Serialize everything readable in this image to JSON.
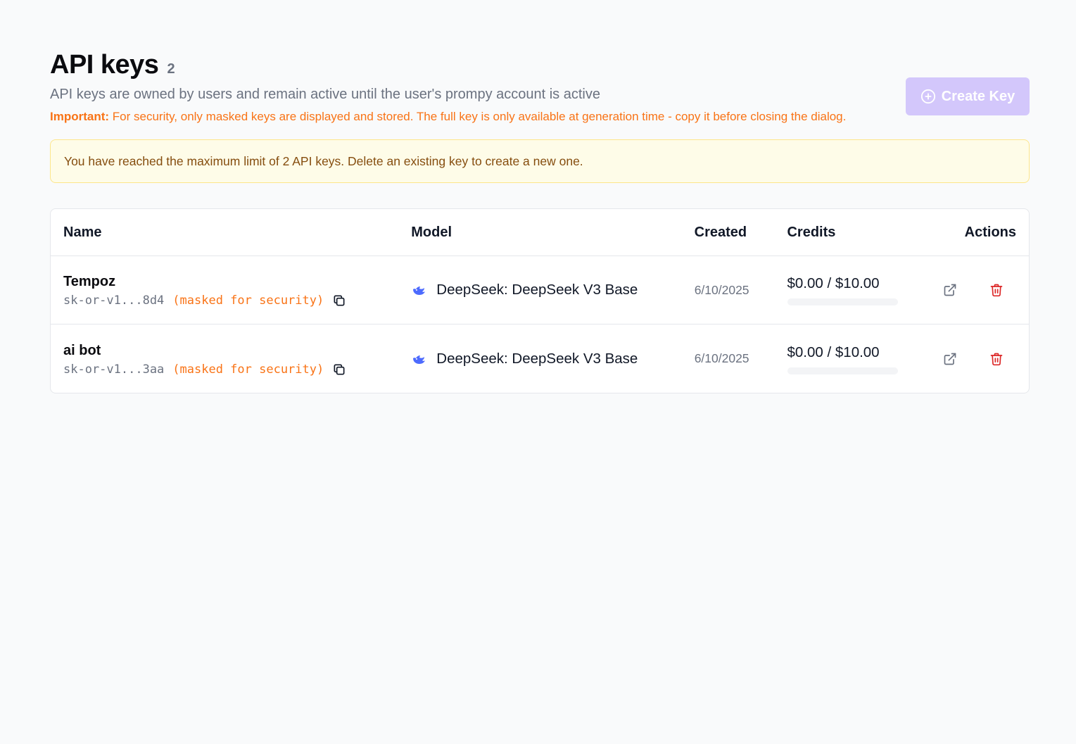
{
  "header": {
    "title": "API keys",
    "count": "2",
    "subtitle": "API keys are owned by users and remain active until the user's prompy account is active",
    "important_label": "Important:",
    "important_text": " For security, only masked keys are displayed and stored. The full key is only available at generation time - copy it before closing the dialog.",
    "create_button": "Create Key"
  },
  "alert": {
    "text": "You have reached the maximum limit of 2 API keys. Delete an existing key to create a new one."
  },
  "table": {
    "columns": {
      "name": "Name",
      "model": "Model",
      "created": "Created",
      "credits": "Credits",
      "actions": "Actions"
    },
    "rows": [
      {
        "name": "Tempoz",
        "key_masked": "sk-or-v1...8d4",
        "key_note": "(masked for security)",
        "model": "DeepSeek: DeepSeek V3 Base",
        "created": "6/10/2025",
        "credits": "$0.00 / $10.00",
        "credits_used_fraction": 0
      },
      {
        "name": "ai bot",
        "key_masked": "sk-or-v1...3aa",
        "key_note": "(masked for security)",
        "model": "DeepSeek: DeepSeek V3 Base",
        "created": "6/10/2025",
        "credits": "$0.00 / $10.00",
        "credits_used_fraction": 0
      }
    ]
  },
  "icons": {
    "create": "plus-circle-icon",
    "copy": "copy-icon",
    "model": "deepseek-whale-icon",
    "open": "external-link-icon",
    "delete": "trash-icon"
  },
  "colors": {
    "accent": "#d3c7fb",
    "important": "#f97316",
    "alert_bg": "#fefce8",
    "alert_text": "#854d0e",
    "delete": "#dc2626",
    "model_icon": "#4d6bfe"
  }
}
